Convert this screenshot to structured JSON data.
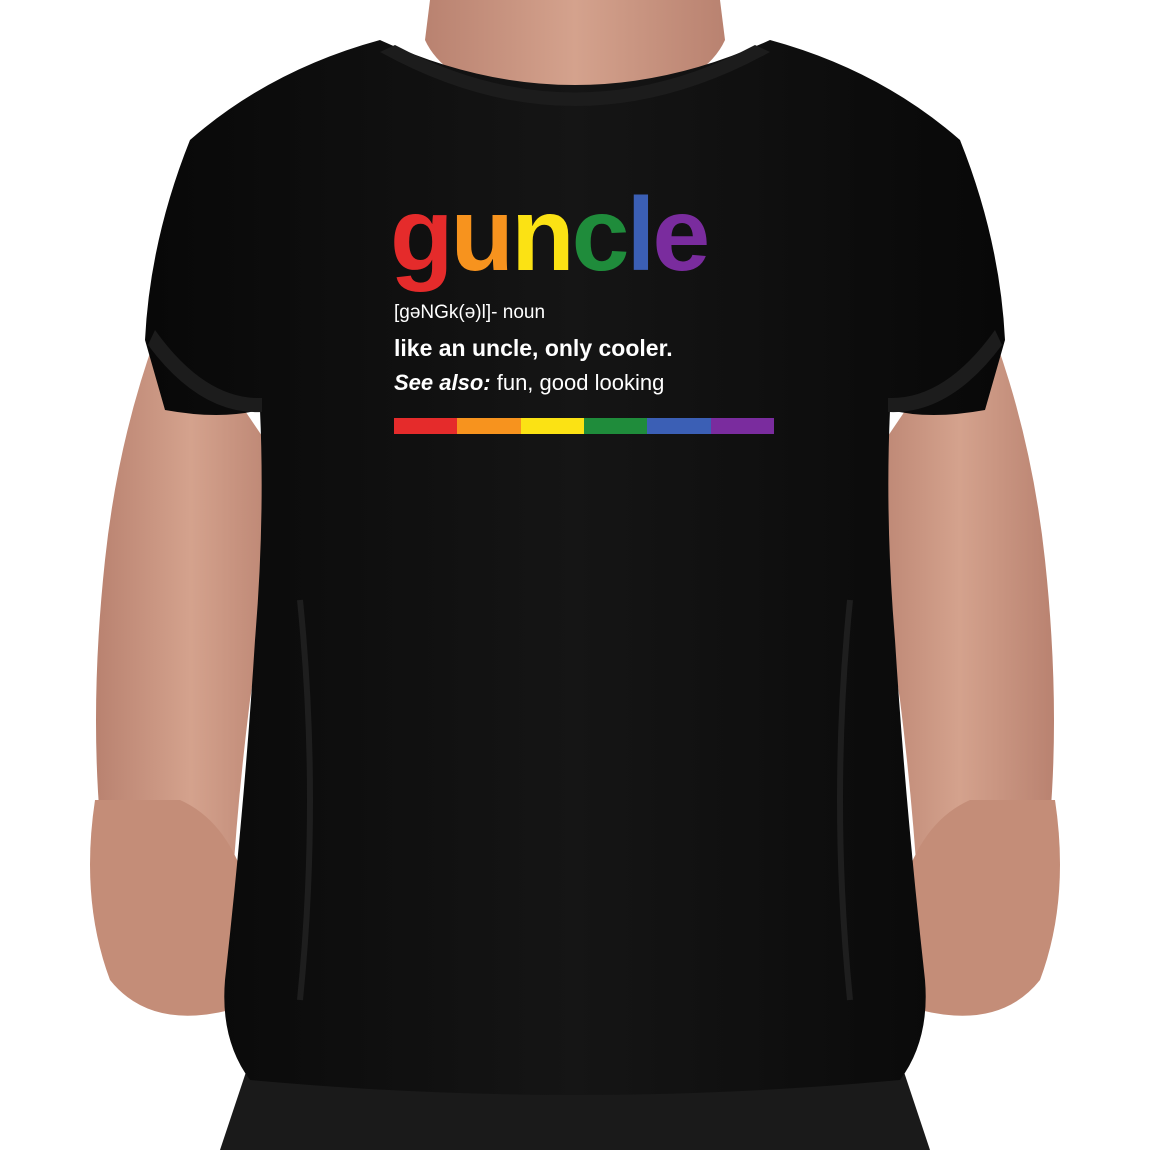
{
  "shirt": {
    "word_letters": [
      {
        "char": "g",
        "color": "#e52b2b"
      },
      {
        "char": "u",
        "color": "#f7931e"
      },
      {
        "char": "n",
        "color": "#f7931e"
      },
      {
        "char": "c",
        "color": "#fbe214"
      },
      {
        "char": "l",
        "color": "#1f8c3b"
      },
      {
        "char": "l2",
        "color": "#3b5fb5"
      },
      {
        "char": "e",
        "color": "#7a2c9e"
      }
    ],
    "word": "guncle",
    "pronunciation": "[gəNGk(ə)l]",
    "part_of_speech": "- noun",
    "definition": "like an uncle, only cooler.",
    "see_also_label": "See also:",
    "see_also_text": " fun, good looking",
    "stripe_colors": [
      "#e52b2b",
      "#f7931e",
      "#fbe214",
      "#1f8c3b",
      "#3b5fb5",
      "#7a2c9e"
    ]
  },
  "colors": {
    "shirt": "#0d0d0d",
    "skin": "#c9957f",
    "background": "#ffffff"
  }
}
